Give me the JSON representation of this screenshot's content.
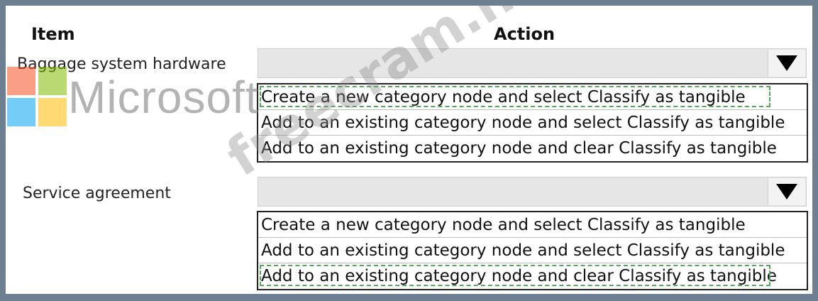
{
  "headers": {
    "item": "Item",
    "action": "Action"
  },
  "rows": [
    {
      "item": "Baggage system hardware",
      "selected_value": "",
      "options": [
        "Create a new category node and select Classify as tangible",
        "Add to an existing category node and select Classify as tangible",
        "Add to an existing category node and clear Classify as tangible"
      ],
      "selected_index": 0
    },
    {
      "item": "Service agreement",
      "selected_value": "",
      "options": [
        "Create a new category node and select Classify as tangible",
        "Add to an existing category node and select Classify as tangible",
        "Add to an existing category node and clear Classify as tangible"
      ],
      "selected_index": 2
    }
  ],
  "watermarks": {
    "brand": "Microsoft",
    "site": "freecram.net"
  },
  "colors": {
    "background": "#6f7f92",
    "dropdown": "#e6e6e6",
    "selection_dash": "#58a55c"
  }
}
